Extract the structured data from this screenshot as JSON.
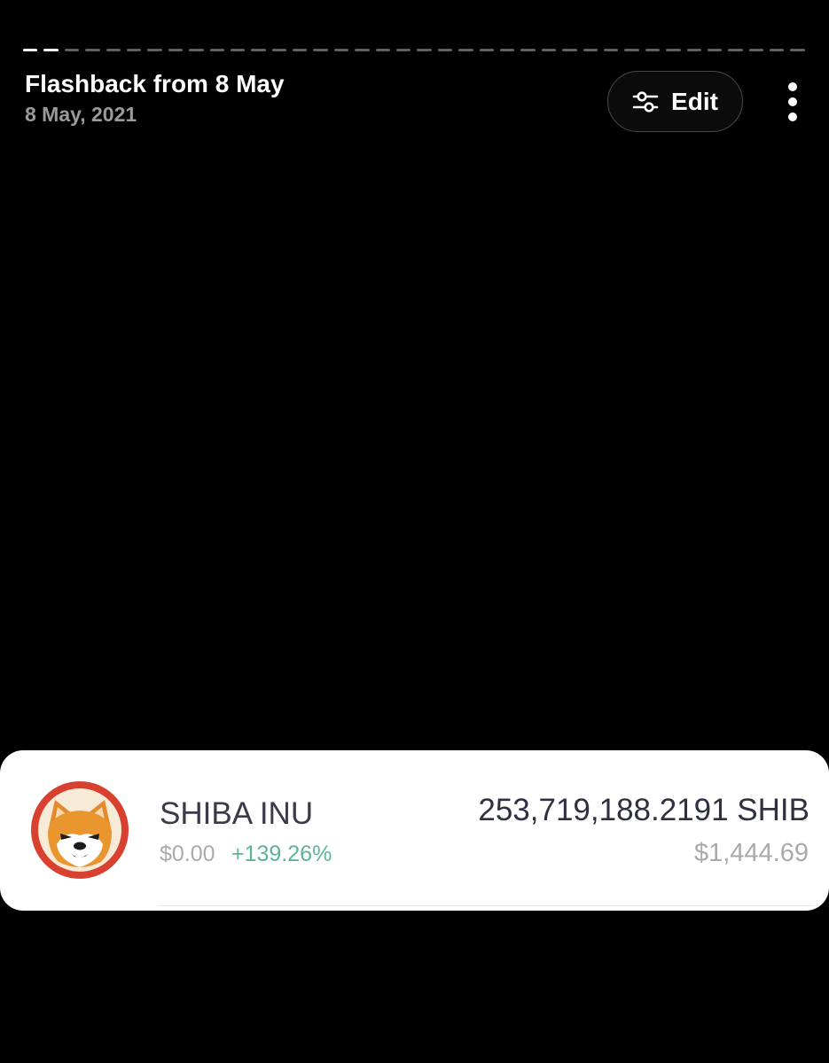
{
  "story": {
    "progress": {
      "total_segments": 38,
      "completed_segments": 2
    }
  },
  "header": {
    "title": "Flashback from 8 May",
    "subtitle": "8 May, 2021",
    "edit_label": "Edit",
    "edit_icon": "sliders-icon",
    "more_icon": "more-vertical-icon"
  },
  "holding": {
    "name": "SHIBA INU",
    "price": "$0.00",
    "change": "+139.26%",
    "amount": "253,719,188.2191 SHIB",
    "value": "$1,444.69",
    "logo_icon": "shiba-inu-logo"
  },
  "colors": {
    "background": "#000000",
    "change_positive": "#5cb39a",
    "logo_ring": "#d8412f"
  }
}
